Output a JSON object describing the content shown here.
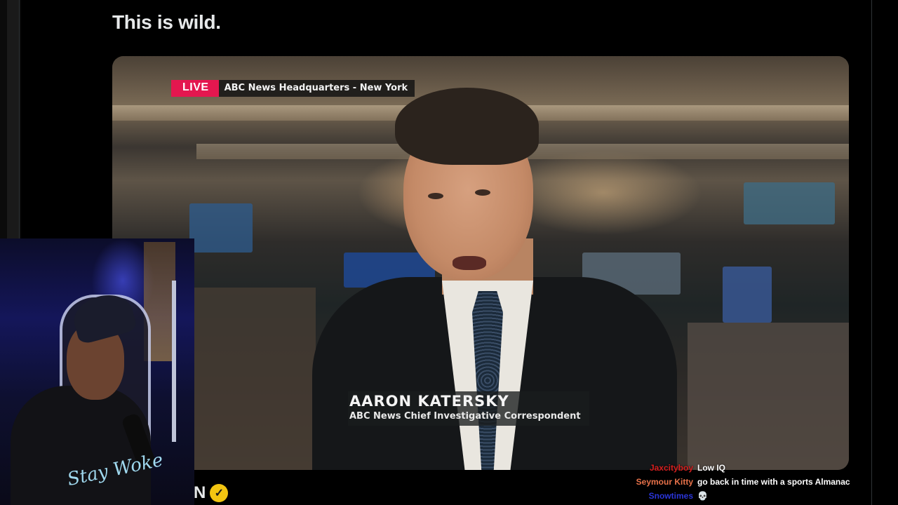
{
  "post": {
    "text": "This is wild."
  },
  "video": {
    "live_label": "LIVE",
    "location": "ABC News Headquarters - New York",
    "lower_third": {
      "name": "AARON KATERSKY",
      "title": "ABC News Chief Investigative Correspondent"
    }
  },
  "webcam": {
    "shirt_text": "Stay Woke"
  },
  "bottom": {
    "fragment": "N",
    "verified_icon": "verified-badge-icon"
  },
  "chat": [
    {
      "user": "Jaxcityboy",
      "color": "#d61f1f",
      "message": "Low IQ"
    },
    {
      "user": "Seymour Kitty",
      "color": "#e8724a",
      "message": "go back in time with a sports Almanac"
    },
    {
      "user": "Snowtimes",
      "color": "#2a35d8",
      "message": "💀"
    }
  ]
}
